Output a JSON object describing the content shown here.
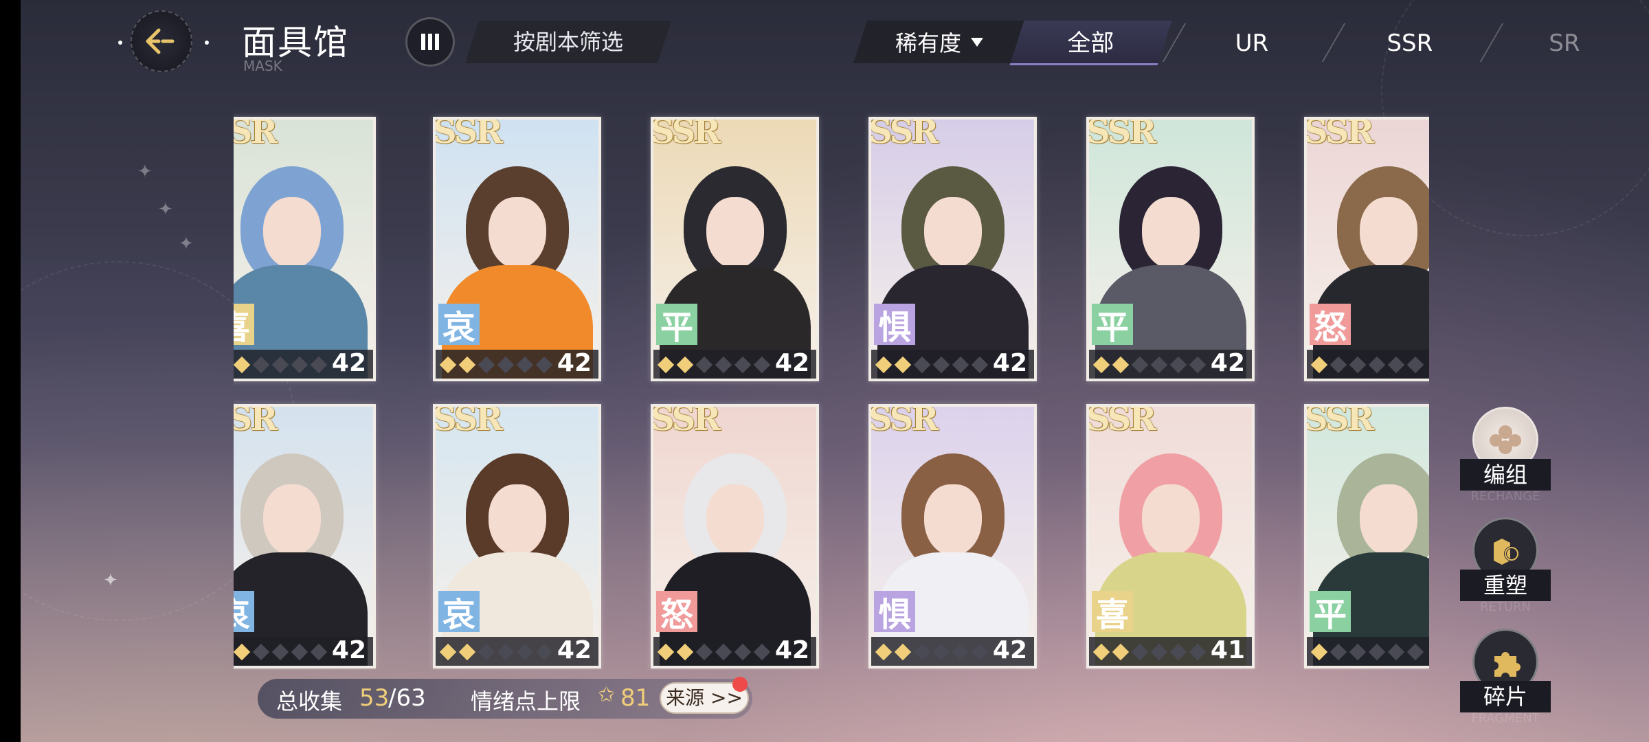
{
  "header": {
    "title": "面具馆",
    "subtitle": "MASK",
    "filter_label": "按剧本筛选",
    "rarity_label": "稀有度",
    "tabs": [
      "全部",
      "UR",
      "SSR",
      "SR"
    ],
    "active_tab": "全部"
  },
  "cards": [
    {
      "rarity": "SSR",
      "emotion": "喜",
      "emotion_color": "#e9d28a",
      "stars": 2,
      "level": "42",
      "bg": "#d9e3d8",
      "hair": "#7ea3d2",
      "outfit": "#5a86a8"
    },
    {
      "rarity": "SSR",
      "emotion": "哀",
      "emotion_color": "#7fb4e3",
      "stars": 2,
      "level": "42",
      "bg": "#cfe2f2",
      "hair": "#5a3f2e",
      "outfit": "#f08a2a"
    },
    {
      "rarity": "SSR",
      "emotion": "平",
      "emotion_color": "#8ad0a0",
      "stars": 2,
      "level": "42",
      "bg": "#ecd9b6",
      "hair": "#2a2a30",
      "outfit": "#2a2828"
    },
    {
      "rarity": "SSR",
      "emotion": "惧",
      "emotion_color": "#b9a3e0",
      "stars": 2,
      "level": "42",
      "bg": "#d6cde8",
      "hair": "#5a5a42",
      "outfit": "#2a2630"
    },
    {
      "rarity": "SSR",
      "emotion": "平",
      "emotion_color": "#8ad0a0",
      "stars": 2,
      "level": "42",
      "bg": "#cfe6da",
      "hair": "#2a2435",
      "outfit": "#5a5a66"
    },
    {
      "rarity": "SSR",
      "emotion": "怒",
      "emotion_color": "#f09a9a",
      "stars": 1,
      "level": "",
      "bg": "#ecd6d6",
      "hair": "#8a6a4a",
      "outfit": "#26282e"
    },
    {
      "rarity": "SSR",
      "emotion": "哀",
      "emotion_color": "#7fb4e3",
      "stars": 2,
      "level": "42",
      "bg": "#d4e2ee",
      "hair": "#cfc8be",
      "outfit": "#25232a"
    },
    {
      "rarity": "SSR",
      "emotion": "哀",
      "emotion_color": "#7fb4e3",
      "stars": 2,
      "level": "42",
      "bg": "#d6e6f0",
      "hair": "#5a3a28",
      "outfit": "#f0e8dc"
    },
    {
      "rarity": "SSR",
      "emotion": "怒",
      "emotion_color": "#f09a9a",
      "stars": 2,
      "level": "42",
      "bg": "#f0d6d0",
      "hair": "#e8e8ea",
      "outfit": "#1e1e24"
    },
    {
      "rarity": "SSR",
      "emotion": "惧",
      "emotion_color": "#b9a3e0",
      "stars": 2,
      "level": "42",
      "bg": "#dcd2ec",
      "hair": "#8a6044",
      "outfit": "#f0f0f4"
    },
    {
      "rarity": "SSR",
      "emotion": "喜",
      "emotion_color": "#e9d28a",
      "stars": 2,
      "level": "41",
      "bg": "#f0dcd8",
      "hair": "#f0a0a4",
      "outfit": "#d8d48a"
    },
    {
      "rarity": "SSR",
      "emotion": "平",
      "emotion_color": "#8ad0a0",
      "stars": 1,
      "level": "",
      "bg": "#d2e8de",
      "hair": "#a9b498",
      "outfit": "#2a3a3a"
    }
  ],
  "status": {
    "collect_label": "总收集",
    "collect_current": "53",
    "collect_total": "/63",
    "emotion_label": "情绪点上限",
    "emotion_value": "81",
    "source_label": "来源 >>"
  },
  "side_buttons": [
    {
      "label": "编组",
      "sub": "RECHANGE",
      "icon": "group-icon"
    },
    {
      "label": "重塑",
      "sub": "RETURN",
      "icon": "reshape-icon"
    },
    {
      "label": "碎片",
      "sub": "FRAGMENT",
      "icon": "puzzle-icon"
    }
  ],
  "colors": {
    "accent_gold": "#f1cf7a",
    "active_tab_line": "#8a80c8",
    "badge_red": "#ef4a4a"
  }
}
